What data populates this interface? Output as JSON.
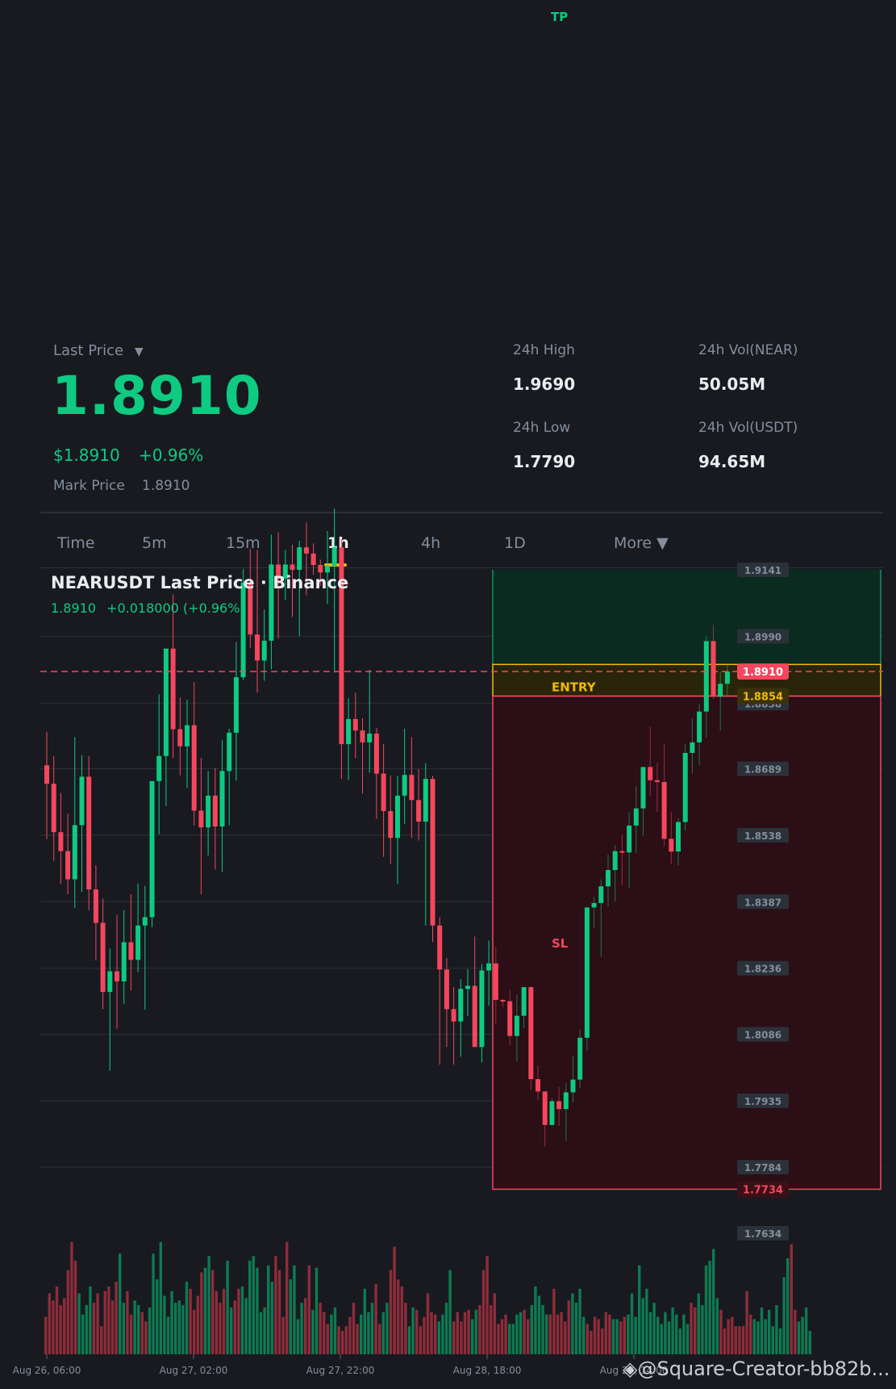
{
  "tp_label": "TP",
  "header": {
    "last_price_label": "Last Price",
    "last_price_caret": "▼",
    "last_price": "1.8910",
    "usd_price": "$1.8910",
    "change_pct": "+0.96%",
    "mark_price_label": "Mark Price",
    "mark_price": "1.8910"
  },
  "stats": {
    "high_label": "24h High",
    "high": "1.9690",
    "low_label": "24h Low",
    "low": "1.7790",
    "vol_near_label": "24h Vol(NEAR)",
    "vol_near": "50.05M",
    "vol_usdt_label": "24h Vol(USDT)",
    "vol_usdt": "94.65M"
  },
  "tabs": [
    {
      "label": "Time"
    },
    {
      "label": "5m"
    },
    {
      "label": "15m"
    },
    {
      "label": "1h",
      "active": true
    },
    {
      "label": "4h"
    },
    {
      "label": "1D"
    },
    {
      "label": "More ▼"
    }
  ],
  "chart_header": {
    "title": "NEARUSDT Last Price · Binance",
    "price": "1.8910",
    "change": "+0.018000 (+0.96%)"
  },
  "zones": {
    "entry_label": "ENTRY",
    "sl_label": "SL"
  },
  "watermark": "◈@Square-Creator-bb82b...",
  "colors": {
    "up": "#0ecb81",
    "down": "#f6465d",
    "entry": "#f0b90b",
    "background": "#181a20"
  },
  "chart_data": {
    "type": "candlestick",
    "interval": "1h",
    "ylim": [
      1.7634,
      1.9141
    ],
    "y_ticks": [
      "1.9141",
      "1.8990",
      "1.8838",
      "1.8689",
      "1.8538",
      "1.8387",
      "1.8236",
      "1.8086",
      "1.7935",
      "1.7784",
      "1.7634"
    ],
    "price_tags": {
      "last": "1.8910",
      "entry": "1.8854",
      "sl": "1.7734"
    },
    "x_ticks": [
      "Aug 26, 06:00",
      "Aug 27, 02:00",
      "Aug 27, 22:00",
      "Aug 28, 18:00",
      "Aug 29, 14:00"
    ],
    "levels": {
      "last": 1.891,
      "entry_top": 1.8926,
      "entry_bottom": 1.8854,
      "sl": 1.7734,
      "tp_zone_bottom": 1.8926
    },
    "candles": [
      {
        "o": 1.8697,
        "h": 1.8773,
        "l": 1.8529,
        "c": 1.8655
      },
      {
        "o": 1.8655,
        "h": 1.8718,
        "l": 1.848,
        "c": 1.8545
      },
      {
        "o": 1.8545,
        "h": 1.8634,
        "l": 1.8427,
        "c": 1.8502
      },
      {
        "o": 1.8502,
        "h": 1.8587,
        "l": 1.8404,
        "c": 1.8438
      },
      {
        "o": 1.8438,
        "h": 1.8761,
        "l": 1.8373,
        "c": 1.8561
      },
      {
        "o": 1.8561,
        "h": 1.872,
        "l": 1.8409,
        "c": 1.8671
      },
      {
        "o": 1.8671,
        "h": 1.8718,
        "l": 1.8368,
        "c": 1.8415
      },
      {
        "o": 1.8415,
        "h": 1.847,
        "l": 1.8254,
        "c": 1.8339
      },
      {
        "o": 1.8339,
        "h": 1.8394,
        "l": 1.8143,
        "c": 1.8182
      },
      {
        "o": 1.8182,
        "h": 1.8281,
        "l": 1.8003,
        "c": 1.8229
      },
      {
        "o": 1.8229,
        "h": 1.8357,
        "l": 1.8099,
        "c": 1.8206
      },
      {
        "o": 1.8206,
        "h": 1.8368,
        "l": 1.8155,
        "c": 1.8295
      },
      {
        "o": 1.8295,
        "h": 1.8404,
        "l": 1.8185,
        "c": 1.8255
      },
      {
        "o": 1.8255,
        "h": 1.8428,
        "l": 1.8227,
        "c": 1.8333
      },
      {
        "o": 1.8333,
        "h": 1.8423,
        "l": 1.8142,
        "c": 1.8352
      },
      {
        "o": 1.8352,
        "h": 1.8577,
        "l": 1.8329,
        "c": 1.8661
      },
      {
        "o": 1.8661,
        "h": 1.8858,
        "l": 1.854,
        "c": 1.8718
      },
      {
        "o": 1.8718,
        "h": 1.8935,
        "l": 1.8604,
        "c": 1.8962
      },
      {
        "o": 1.8962,
        "h": 1.9085,
        "l": 1.8713,
        "c": 1.8779
      },
      {
        "o": 1.8779,
        "h": 1.8851,
        "l": 1.8674,
        "c": 1.874
      },
      {
        "o": 1.874,
        "h": 1.8846,
        "l": 1.8646,
        "c": 1.8788
      },
      {
        "o": 1.8788,
        "h": 1.8886,
        "l": 1.856,
        "c": 1.8594
      },
      {
        "o": 1.8594,
        "h": 1.8714,
        "l": 1.8404,
        "c": 1.8556
      },
      {
        "o": 1.8556,
        "h": 1.8684,
        "l": 1.8492,
        "c": 1.8628
      },
      {
        "o": 1.8628,
        "h": 1.8691,
        "l": 1.846,
        "c": 1.8558
      },
      {
        "o": 1.8558,
        "h": 1.8754,
        "l": 1.8455,
        "c": 1.8684
      },
      {
        "o": 1.8684,
        "h": 1.878,
        "l": 1.8561,
        "c": 1.8771
      },
      {
        "o": 1.8771,
        "h": 1.8977,
        "l": 1.8662,
        "c": 1.8897
      },
      {
        "o": 1.8897,
        "h": 1.9143,
        "l": 1.8891,
        "c": 1.9112
      },
      {
        "o": 1.9112,
        "h": 1.9189,
        "l": 1.8964,
        "c": 1.8994
      },
      {
        "o": 1.8994,
        "h": 1.9186,
        "l": 1.8862,
        "c": 1.8935
      },
      {
        "o": 1.8935,
        "h": 1.9051,
        "l": 1.8889,
        "c": 1.898
      },
      {
        "o": 1.898,
        "h": 1.9221,
        "l": 1.8915,
        "c": 1.9153
      },
      {
        "o": 1.9153,
        "h": 1.9226,
        "l": 1.8985,
        "c": 1.9121
      },
      {
        "o": 1.9121,
        "h": 1.9186,
        "l": 1.9072,
        "c": 1.9153
      },
      {
        "o": 1.9153,
        "h": 1.9198,
        "l": 1.9034,
        "c": 1.9141
      },
      {
        "o": 1.9141,
        "h": 1.9207,
        "l": 1.899,
        "c": 1.9192
      },
      {
        "o": 1.9192,
        "h": 1.9248,
        "l": 1.9083,
        "c": 1.9178
      },
      {
        "o": 1.9178,
        "h": 1.9201,
        "l": 1.913,
        "c": 1.9152
      },
      {
        "o": 1.9152,
        "h": 1.9164,
        "l": 1.9104,
        "c": 1.9135
      },
      {
        "o": 1.9135,
        "h": 1.9229,
        "l": 1.9063,
        "c": 1.915
      },
      {
        "o": 1.915,
        "h": 1.928,
        "l": 1.8907,
        "c": 1.9192
      },
      {
        "o": 1.9192,
        "h": 1.921,
        "l": 1.8666,
        "c": 1.8745
      },
      {
        "o": 1.8745,
        "h": 1.8849,
        "l": 1.8663,
        "c": 1.8802
      },
      {
        "o": 1.8802,
        "h": 1.8862,
        "l": 1.8713,
        "c": 1.8776
      },
      {
        "o": 1.8776,
        "h": 1.8804,
        "l": 1.8633,
        "c": 1.8749
      },
      {
        "o": 1.8749,
        "h": 1.8914,
        "l": 1.868,
        "c": 1.8769
      },
      {
        "o": 1.8769,
        "h": 1.8782,
        "l": 1.8575,
        "c": 1.8678
      },
      {
        "o": 1.8678,
        "h": 1.8745,
        "l": 1.8489,
        "c": 1.8593
      },
      {
        "o": 1.8593,
        "h": 1.8674,
        "l": 1.8473,
        "c": 1.8532
      },
      {
        "o": 1.8532,
        "h": 1.8673,
        "l": 1.8427,
        "c": 1.8628
      },
      {
        "o": 1.8628,
        "h": 1.878,
        "l": 1.8564,
        "c": 1.8675
      },
      {
        "o": 1.8675,
        "h": 1.8761,
        "l": 1.8532,
        "c": 1.8618
      },
      {
        "o": 1.8618,
        "h": 1.8688,
        "l": 1.8526,
        "c": 1.8569
      },
      {
        "o": 1.8569,
        "h": 1.8702,
        "l": 1.8333,
        "c": 1.8666
      },
      {
        "o": 1.8666,
        "h": 1.8673,
        "l": 1.8296,
        "c": 1.8333
      },
      {
        "o": 1.8333,
        "h": 1.8352,
        "l": 1.8017,
        "c": 1.8233
      },
      {
        "o": 1.8233,
        "h": 1.8259,
        "l": 1.8057,
        "c": 1.8143
      },
      {
        "o": 1.8143,
        "h": 1.8193,
        "l": 1.8017,
        "c": 1.8115
      },
      {
        "o": 1.8115,
        "h": 1.8211,
        "l": 1.8035,
        "c": 1.8189
      },
      {
        "o": 1.8189,
        "h": 1.8234,
        "l": 1.8127,
        "c": 1.8196
      },
      {
        "o": 1.8196,
        "h": 1.8308,
        "l": 1.8069,
        "c": 1.8057
      },
      {
        "o": 1.8057,
        "h": 1.8245,
        "l": 1.8022,
        "c": 1.8231
      },
      {
        "o": 1.8231,
        "h": 1.8299,
        "l": 1.8151,
        "c": 1.8247
      }
    ],
    "candles_after_entry": [
      {
        "o": 1.8247,
        "h": 1.8285,
        "l": 1.8108,
        "c": 1.8164
      },
      {
        "o": 1.8164,
        "h": 1.8166,
        "l": 1.8148,
        "c": 1.8161
      },
      {
        "o": 1.8161,
        "h": 1.8186,
        "l": 1.8061,
        "c": 1.8082
      },
      {
        "o": 1.8082,
        "h": 1.8176,
        "l": 1.8024,
        "c": 1.8128
      },
      {
        "o": 1.8128,
        "h": 1.8161,
        "l": 1.81,
        "c": 1.8193
      },
      {
        "o": 1.8193,
        "h": 1.8195,
        "l": 1.7959,
        "c": 1.7984
      },
      {
        "o": 1.7984,
        "h": 1.8015,
        "l": 1.7936,
        "c": 1.7956
      },
      {
        "o": 1.7956,
        "h": 1.7929,
        "l": 1.7831,
        "c": 1.788
      },
      {
        "o": 1.788,
        "h": 1.7941,
        "l": 1.7878,
        "c": 1.7934
      },
      {
        "o": 1.7934,
        "h": 1.7966,
        "l": 1.7878,
        "c": 1.7916
      },
      {
        "o": 1.7916,
        "h": 1.7975,
        "l": 1.7843,
        "c": 1.7954
      },
      {
        "o": 1.7954,
        "h": 1.8037,
        "l": 1.7931,
        "c": 1.7983
      },
      {
        "o": 1.7983,
        "h": 1.8096,
        "l": 1.7965,
        "c": 1.8078
      },
      {
        "o": 1.8078,
        "h": 1.8366,
        "l": 1.8048,
        "c": 1.8374
      },
      {
        "o": 1.8374,
        "h": 1.8398,
        "l": 1.8327,
        "c": 1.8384
      },
      {
        "o": 1.8384,
        "h": 1.8438,
        "l": 1.8262,
        "c": 1.8422
      },
      {
        "o": 1.8422,
        "h": 1.8494,
        "l": 1.8376,
        "c": 1.8459
      },
      {
        "o": 1.8459,
        "h": 1.8516,
        "l": 1.8387,
        "c": 1.8502
      },
      {
        "o": 1.8502,
        "h": 1.8539,
        "l": 1.8425,
        "c": 1.8499
      },
      {
        "o": 1.8499,
        "h": 1.859,
        "l": 1.8419,
        "c": 1.856
      },
      {
        "o": 1.856,
        "h": 1.865,
        "l": 1.8498,
        "c": 1.8599
      },
      {
        "o": 1.8599,
        "h": 1.8691,
        "l": 1.8537,
        "c": 1.8693
      },
      {
        "o": 1.8693,
        "h": 1.8784,
        "l": 1.8627,
        "c": 1.8663
      },
      {
        "o": 1.8663,
        "h": 1.8702,
        "l": 1.8591,
        "c": 1.8659
      },
      {
        "o": 1.8659,
        "h": 1.8745,
        "l": 1.8513,
        "c": 1.853
      },
      {
        "o": 1.853,
        "h": 1.8592,
        "l": 1.8472,
        "c": 1.8501
      },
      {
        "o": 1.8501,
        "h": 1.8577,
        "l": 1.8469,
        "c": 1.8568
      },
      {
        "o": 1.8568,
        "h": 1.8745,
        "l": 1.8548,
        "c": 1.8725
      },
      {
        "o": 1.8725,
        "h": 1.8804,
        "l": 1.8679,
        "c": 1.8749
      },
      {
        "o": 1.8749,
        "h": 1.8836,
        "l": 1.8697,
        "c": 1.8819
      },
      {
        "o": 1.8819,
        "h": 1.899,
        "l": 1.876,
        "c": 1.8979
      },
      {
        "o": 1.8979,
        "h": 1.9016,
        "l": 1.8848,
        "c": 1.8853
      },
      {
        "o": 1.8853,
        "h": 1.891,
        "l": 1.8775,
        "c": 1.8882
      },
      {
        "o": 1.8882,
        "h": 1.8924,
        "l": 1.8856,
        "c": 1.891
      }
    ],
    "volume": [
      16,
      26,
      23,
      29,
      21,
      24,
      36,
      48,
      40,
      26,
      17,
      21,
      29,
      22,
      26,
      12,
      27,
      29,
      23,
      31,
      43,
      22,
      27,
      17,
      23,
      21,
      18,
      14,
      20,
      43,
      32,
      48,
      25,
      16,
      27,
      22,
      23,
      21,
      31,
      28,
      19,
      25,
      35,
      37,
      42,
      36,
      27,
      22,
      28,
      40,
      20,
      23,
      28,
      29,
      24,
      40,
      42,
      37,
      18,
      20,
      38,
      31,
      42,
      36,
      16,
      48,
      32,
      38,
      15,
      22,
      24,
      38,
      19,
      37,
      22,
      18,
      13,
      17,
      20,
      12,
      10,
      12,
      16,
      22,
      13,
      17,
      28,
      18,
      22,
      30,
      13,
      18,
      22,
      36,
      46,
      32,
      29,
      22,
      12,
      20,
      19,
      12,
      16,
      26,
      18,
      17,
      14,
      17,
      22,
      36,
      14,
      18,
      14,
      18,
      19,
      15,
      19,
      21,
      36,
      42,
      21,
      26,
      13,
      15,
      17,
      13,
      13,
      17,
      18,
      19,
      15,
      21,
      29,
      25,
      21,
      17,
      17,
      28,
      17,
      18,
      14,
      23,
      26,
      22,
      28,
      16,
      13,
      10,
      16,
      15,
      11,
      18,
      17,
      15,
      15,
      14,
      16,
      17,
      26,
      16,
      38,
      24,
      28,
      18,
      22,
      16,
      13,
      18,
      14,
      20,
      17,
      11,
      17,
      13,
      22,
      20,
      26,
      21,
      38,
      40,
      45,
      24,
      19,
      11,
      15,
      16,
      12,
      12,
      12,
      27,
      17,
      15,
      14,
      20,
      15,
      19,
      12,
      21,
      11,
      33,
      41,
      47,
      19,
      14,
      16,
      20,
      10
    ]
  }
}
